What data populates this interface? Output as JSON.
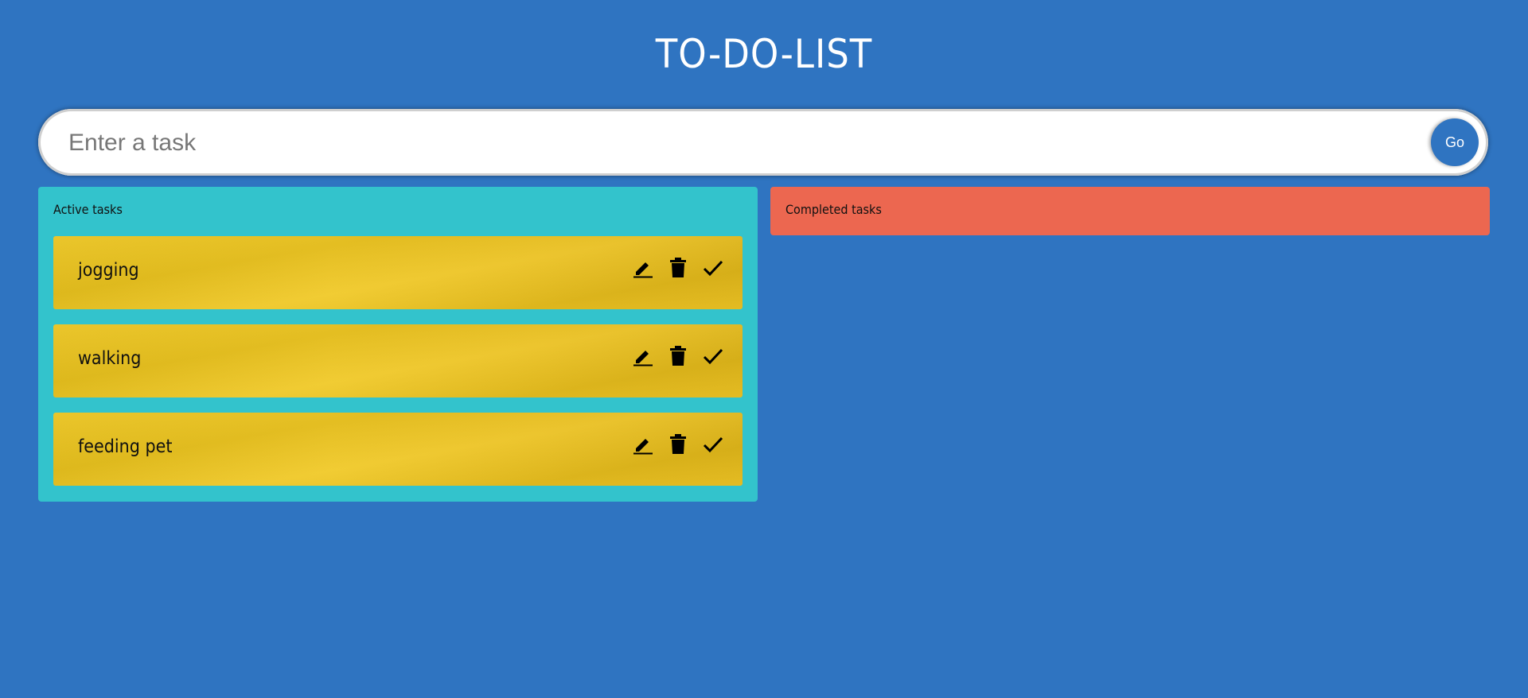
{
  "header": {
    "title": "TO-DO-LIST"
  },
  "task_entry": {
    "placeholder": "Enter a task",
    "value": "",
    "submit_label": "Go"
  },
  "active_panel": {
    "heading": "Active tasks",
    "tasks": [
      {
        "label": "jogging",
        "actions": [
          "edit-icon",
          "trash-icon",
          "check-icon"
        ]
      },
      {
        "label": "walking",
        "actions": [
          "edit-icon",
          "trash-icon",
          "check-icon"
        ]
      },
      {
        "label": "feeding pet",
        "actions": [
          "edit-icon",
          "trash-icon",
          "check-icon"
        ]
      }
    ]
  },
  "completed_panel": {
    "heading": "Completed tasks",
    "tasks": []
  },
  "colors": {
    "background": "#2f74c1",
    "active_panel": "#33c3cc",
    "completed_panel": "#ec6750",
    "task_card": "#efc623",
    "go_button": "#2f74c1"
  }
}
